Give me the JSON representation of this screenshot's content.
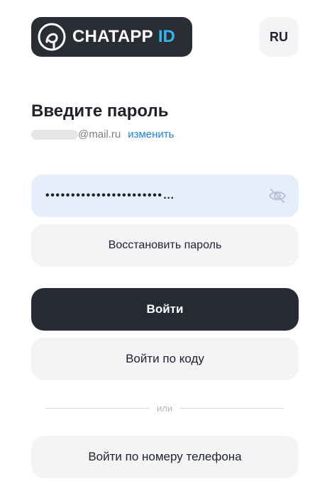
{
  "header": {
    "logo_text": "CHATAPP",
    "logo_accent": "ID",
    "language": "RU"
  },
  "login": {
    "title": "Введите пароль",
    "email_domain": "@mail.ru",
    "change_link": "изменить",
    "password_masked": "•••••••••••••••••••••••…",
    "restore_button": "Восстановить пароль",
    "login_button": "Войти",
    "login_code_button": "Войти по коду",
    "divider_text": "или",
    "phone_button": "Войти по номеру телефона"
  },
  "colors": {
    "accent": "#2fb7ea",
    "link": "#1a82e8",
    "primary_button": "#262a35",
    "password_field_bg": "#e6eefb"
  }
}
